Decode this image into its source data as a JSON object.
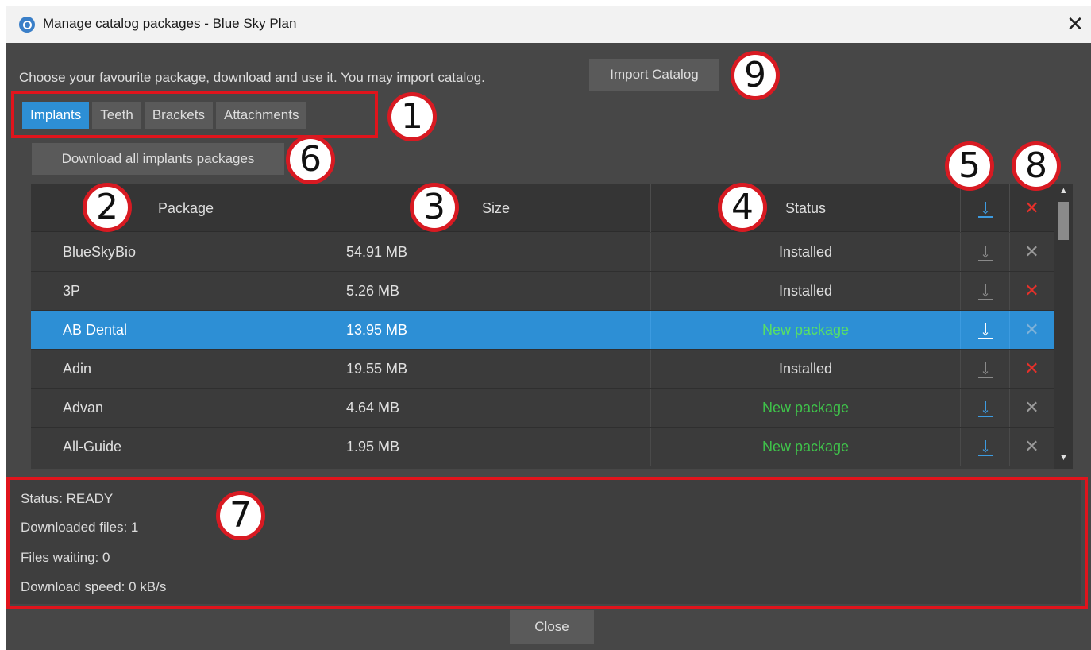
{
  "window": {
    "title": "Manage catalog packages - Blue Sky Plan",
    "close_glyph": "✕"
  },
  "intro_text": "Choose your favourite package, download and use it. You may import catalog.",
  "import_button": "Import Catalog",
  "tabs": [
    {
      "label": "Implants",
      "active": true
    },
    {
      "label": "Teeth",
      "active": false
    },
    {
      "label": "Brackets",
      "active": false
    },
    {
      "label": "Attachments",
      "active": false
    }
  ],
  "download_all_button": "Download all implants packages",
  "table": {
    "headers": {
      "package": "Package",
      "size": "Size",
      "status": "Status"
    },
    "rows": [
      {
        "package": "BlueSkyBio",
        "size": "54.91 MB",
        "status": "Installed"
      },
      {
        "package": "3P",
        "size": "5.26 MB",
        "status": "Installed"
      },
      {
        "package": "AB Dental",
        "size": "13.95 MB",
        "status": "New package"
      },
      {
        "package": "Adin",
        "size": "19.55 MB",
        "status": "Installed"
      },
      {
        "package": "Advan",
        "size": "4.64 MB",
        "status": "New package"
      },
      {
        "package": "All-Guide",
        "size": "1.95 MB",
        "status": "New package"
      }
    ]
  },
  "status_panel": {
    "status": "Status:  READY",
    "downloaded": "Downloaded files:  1",
    "waiting": "Files waiting:  0",
    "speed": "Download speed:  0 kB/s"
  },
  "close_button": "Close",
  "annotations": {
    "b1": "1",
    "b2": "2",
    "b3": "3",
    "b4": "4",
    "b5": "5",
    "b6": "6",
    "b7": "7",
    "b8": "8",
    "b9": "9"
  },
  "icons": {
    "remove": "✕",
    "scroll_up": "▲",
    "scroll_down": "▼"
  },
  "colors": {
    "accent": "#2d8fd5",
    "new_package": "#3fc34a",
    "remove_red": "#e8302a",
    "annotation_red": "#e0141c"
  }
}
